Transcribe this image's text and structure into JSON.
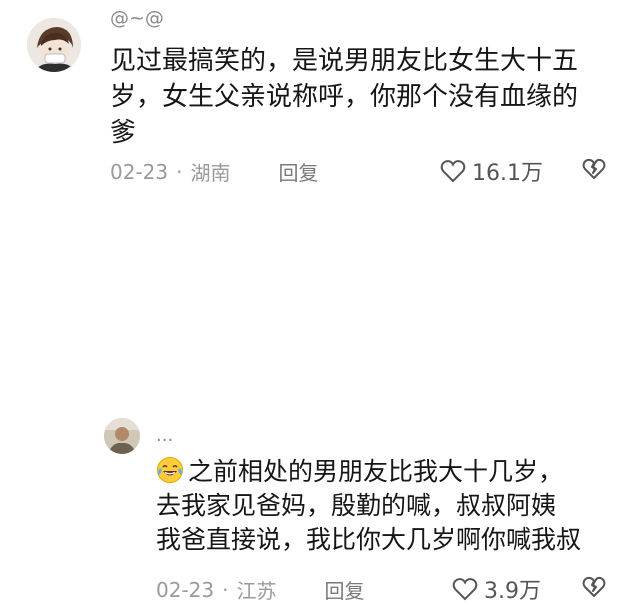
{
  "comments": [
    {
      "username": "@~@",
      "lines": [
        "见过最搞笑的，是说男朋友比女生大十五",
        "岁，女生父亲说称呼，你那个没有血缘的",
        "爹"
      ],
      "date": "02-23",
      "separator": "·",
      "location": "湖南",
      "reply_label": "回复",
      "likes": "16.1万"
    },
    {
      "username": "...",
      "emoji": "laughing-tears-emoji",
      "lines": [
        "之前相处的男朋友比我大十几岁，",
        "去我家见爸妈，殷勤的喊，叔叔阿姨",
        "我爸直接说，我比你大几岁啊你喊我叔"
      ],
      "date": "02-23",
      "separator": "·",
      "location": "江苏",
      "reply_label": "回复",
      "likes": "3.9万"
    }
  ],
  "colors": {
    "text": "#161616",
    "meta": "#9a9a9a",
    "username": "#8a8a8a",
    "icon": "#555555"
  },
  "icons": {
    "like": "heart-outline-icon",
    "dislike": "broken-heart-icon"
  }
}
